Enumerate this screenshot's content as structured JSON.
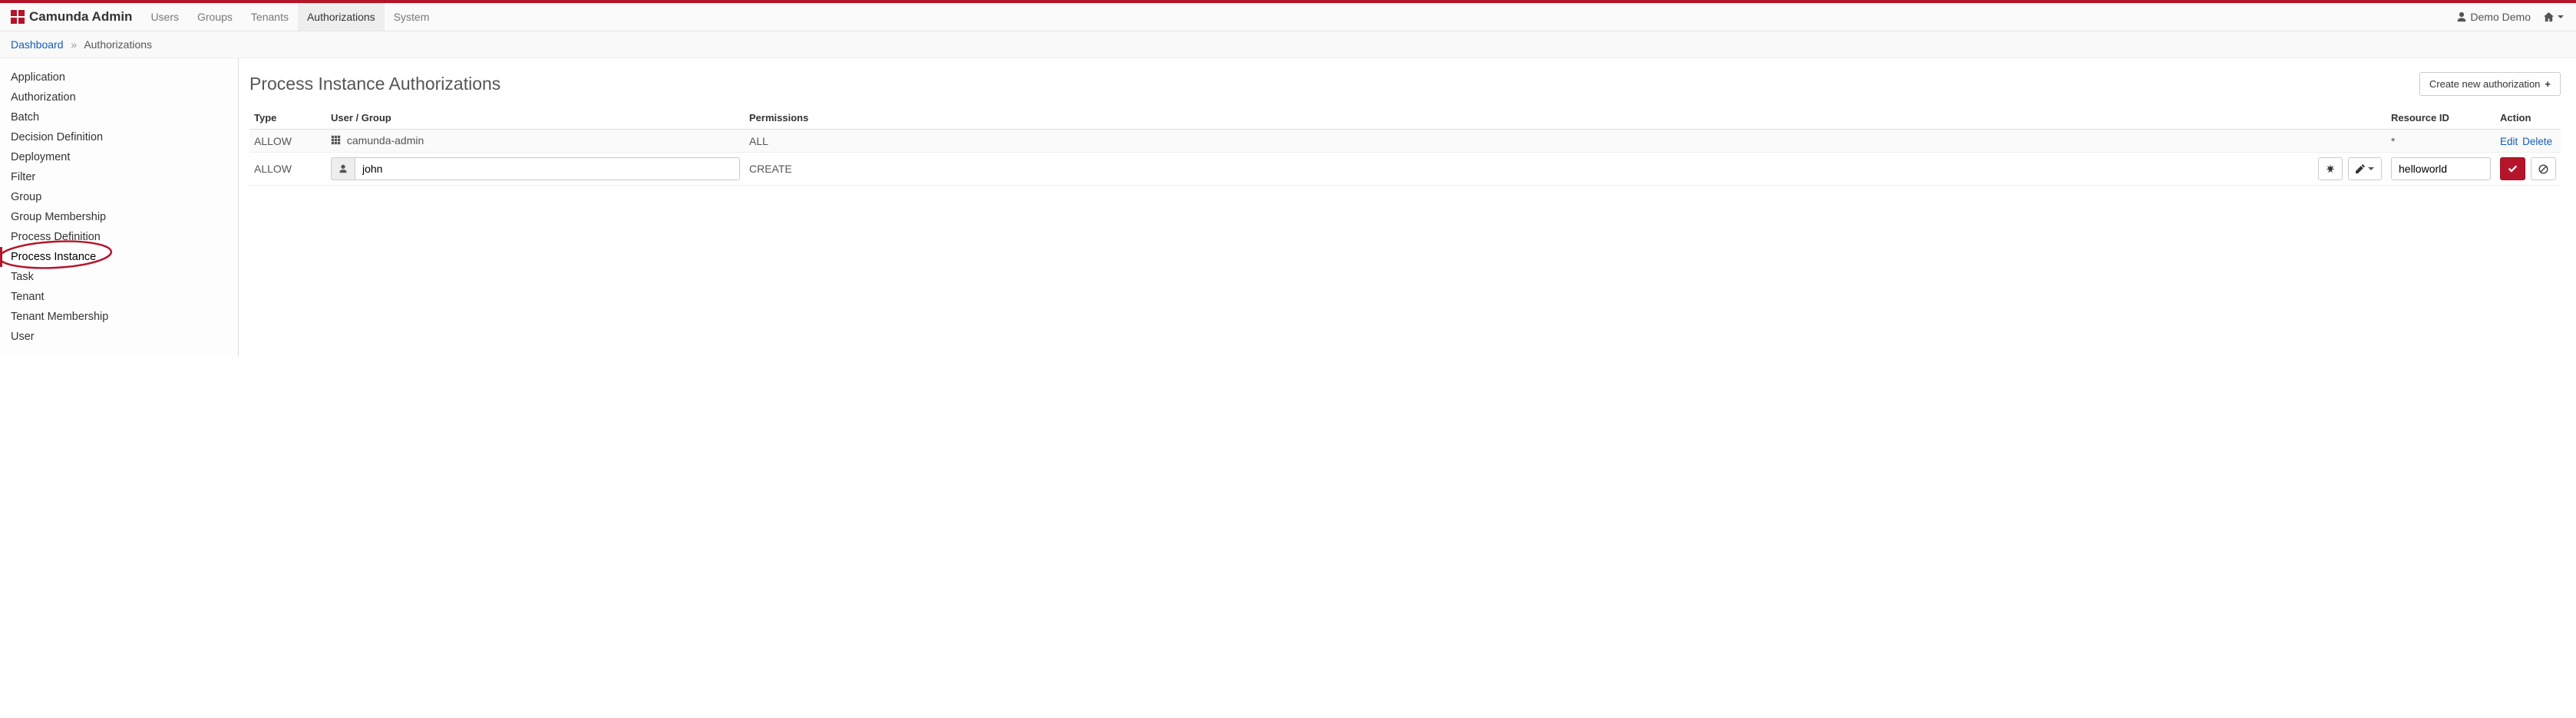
{
  "brand": "Camunda Admin",
  "nav": [
    "Users",
    "Groups",
    "Tenants",
    "Authorizations",
    "System"
  ],
  "active_nav": 3,
  "user_name": "Demo Demo",
  "breadcrumb": {
    "root": "Dashboard",
    "sep": "»",
    "current": "Authorizations"
  },
  "sidebar": {
    "items": [
      "Application",
      "Authorization",
      "Batch",
      "Decision Definition",
      "Deployment",
      "Filter",
      "Group",
      "Group Membership",
      "Process Definition",
      "Process Instance",
      "Task",
      "Tenant",
      "Tenant Membership",
      "User"
    ],
    "active_index": 9
  },
  "page_title": "Process Instance Authorizations",
  "create_button": "Create new authorization",
  "table": {
    "headers": [
      "Type",
      "User / Group",
      "Permissions",
      "Resource ID",
      "Action"
    ],
    "rows": [
      {
        "type": "ALLOW",
        "user_group": "camunda-admin",
        "is_group": true,
        "permissions": "ALL",
        "resource_id": "*",
        "actions": {
          "edit": "Edit",
          "delete": "Delete"
        }
      }
    ],
    "edit_row": {
      "type": "ALLOW",
      "user_value": "john",
      "permissions": "CREATE",
      "resource_value": "helloworld"
    }
  }
}
